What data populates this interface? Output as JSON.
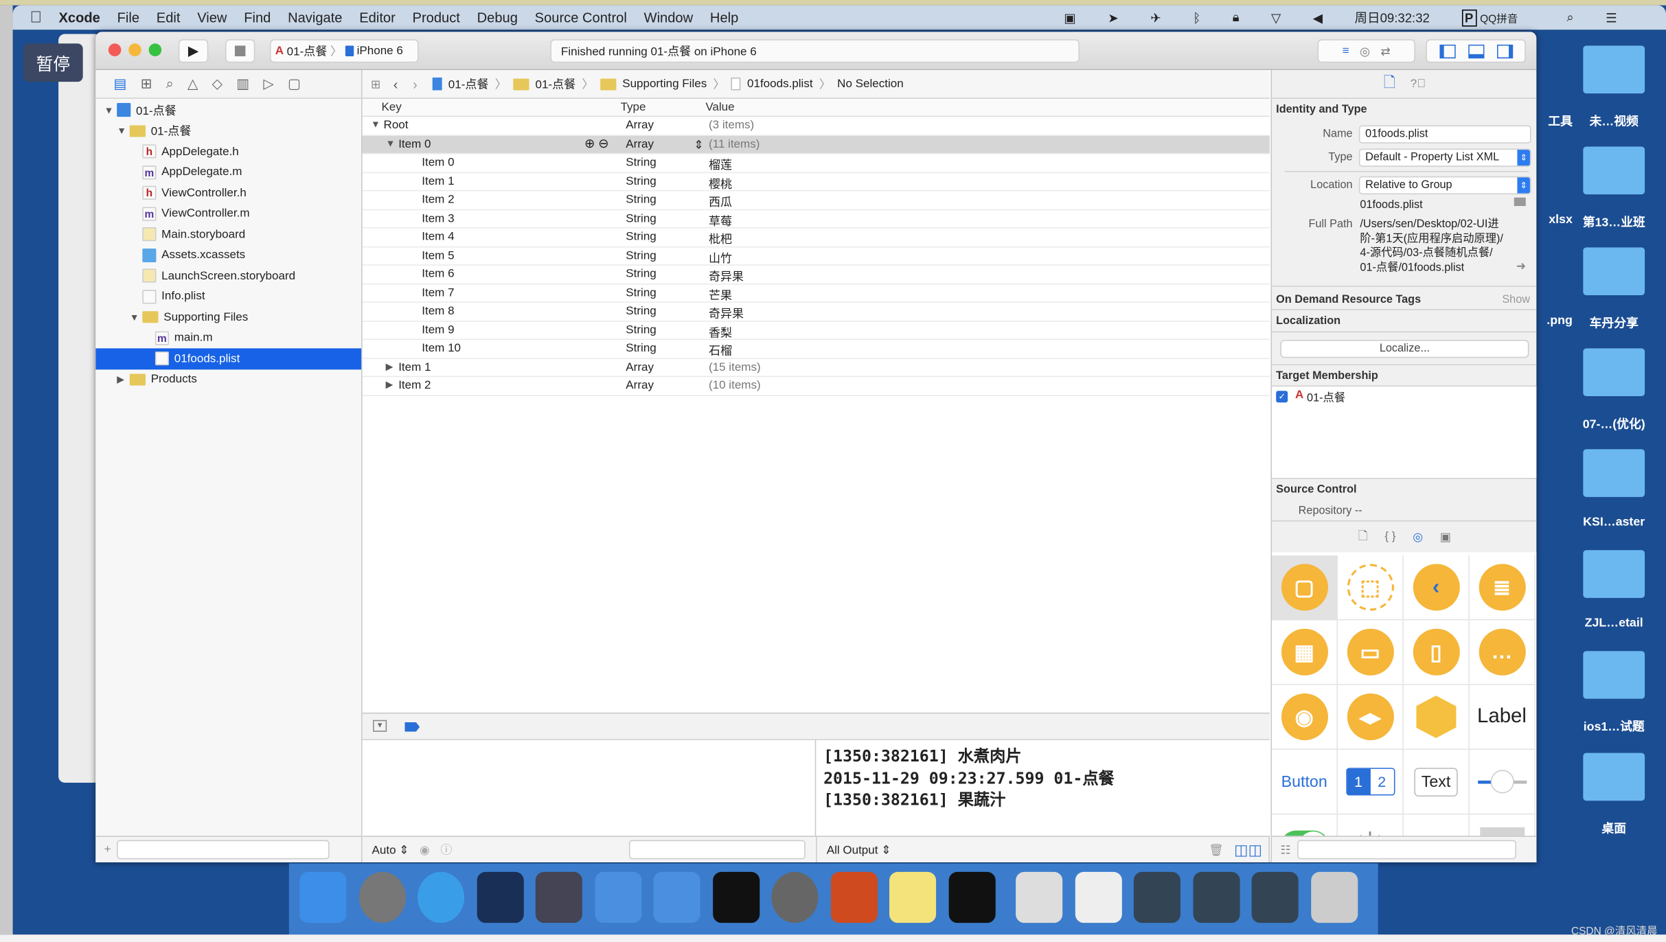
{
  "menubar": {
    "items": [
      "Xcode",
      "File",
      "Edit",
      "View",
      "Find",
      "Navigate",
      "Editor",
      "Product",
      "Debug",
      "Source Control",
      "Window",
      "Help"
    ],
    "clock": "周日09:32:32",
    "ime": "QQ拼音"
  },
  "overlay": {
    "pause": "暂停"
  },
  "toolbar": {
    "scheme": "01-点餐",
    "device": "iPhone 6",
    "activity": "Finished running 01-点餐 on iPhone 6"
  },
  "jumpbar": [
    "01-点餐",
    "01-点餐",
    "Supporting Files",
    "01foods.plist",
    "No Selection"
  ],
  "navigator": {
    "items": [
      {
        "label": "01-点餐",
        "kind": "project",
        "depth": 0,
        "open": true
      },
      {
        "label": "01-点餐",
        "kind": "folder",
        "depth": 1,
        "open": true
      },
      {
        "label": "AppDelegate.h",
        "kind": "h",
        "depth": 2
      },
      {
        "label": "AppDelegate.m",
        "kind": "m",
        "depth": 2
      },
      {
        "label": "ViewController.h",
        "kind": "h",
        "depth": 2
      },
      {
        "label": "ViewController.m",
        "kind": "m",
        "depth": 2
      },
      {
        "label": "Main.storyboard",
        "kind": "storyboard",
        "depth": 2
      },
      {
        "label": "Assets.xcassets",
        "kind": "assets",
        "depth": 2
      },
      {
        "label": "LaunchScreen.storyboard",
        "kind": "storyboard",
        "depth": 2
      },
      {
        "label": "Info.plist",
        "kind": "plist",
        "depth": 2
      },
      {
        "label": "Supporting Files",
        "kind": "folder",
        "depth": 2,
        "open": true
      },
      {
        "label": "main.m",
        "kind": "m",
        "depth": 3
      },
      {
        "label": "01foods.plist",
        "kind": "plist",
        "depth": 3,
        "selected": true
      },
      {
        "label": "Products",
        "kind": "folder",
        "depth": 1,
        "open": false
      }
    ]
  },
  "plist": {
    "headers": {
      "key": "Key",
      "type": "Type",
      "value": "Value"
    },
    "rows": [
      {
        "key": "Root",
        "type": "Array",
        "value": "(3 items)",
        "depth": 0,
        "disc": "open"
      },
      {
        "key": "Item 0",
        "type": "Array",
        "value": "(11 items)",
        "depth": 1,
        "disc": "open",
        "highlight": true
      },
      {
        "key": "Item 0",
        "type": "String",
        "value": "榴莲",
        "depth": 2
      },
      {
        "key": "Item 1",
        "type": "String",
        "value": "樱桃",
        "depth": 2
      },
      {
        "key": "Item 2",
        "type": "String",
        "value": "西瓜",
        "depth": 2
      },
      {
        "key": "Item 3",
        "type": "String",
        "value": "草莓",
        "depth": 2
      },
      {
        "key": "Item 4",
        "type": "String",
        "value": "枇杷",
        "depth": 2
      },
      {
        "key": "Item 5",
        "type": "String",
        "value": "山竹",
        "depth": 2
      },
      {
        "key": "Item 6",
        "type": "String",
        "value": "奇异果",
        "depth": 2
      },
      {
        "key": "Item 7",
        "type": "String",
        "value": "芒果",
        "depth": 2
      },
      {
        "key": "Item 8",
        "type": "String",
        "value": "奇异果",
        "depth": 2
      },
      {
        "key": "Item 9",
        "type": "String",
        "value": "香梨",
        "depth": 2
      },
      {
        "key": "Item 10",
        "type": "String",
        "value": "石榴",
        "depth": 2
      },
      {
        "key": "Item 1",
        "type": "Array",
        "value": "(15 items)",
        "depth": 1,
        "disc": "closed"
      },
      {
        "key": "Item 2",
        "type": "Array",
        "value": "(10 items)",
        "depth": 1,
        "disc": "closed"
      }
    ]
  },
  "console": {
    "lines": [
      "[1350:382161] 水煮肉片",
      "2015-11-29 09:23:27.599 01-点餐",
      "[1350:382161] 果蔬汁"
    ],
    "filter": "All Output"
  },
  "debug": {
    "auto": "Auto"
  },
  "inspector": {
    "identity_title": "Identity and Type",
    "name_label": "Name",
    "name": "01foods.plist",
    "type_label": "Type",
    "type": "Default - Property List XML",
    "location_label": "Location",
    "location": "Relative to Group",
    "filename": "01foods.plist",
    "fullpath_label": "Full Path",
    "fullpath": [
      "/Users/sen/Desktop/02-UI进",
      "阶-第1天(应用程序启动原理)/",
      "4-源代码/03-点餐随机点餐/",
      "01-点餐/01foods.plist"
    ],
    "odr_title": "On Demand Resource Tags",
    "odr_show": "Show",
    "loc_title": "Localization",
    "localize": "Localize...",
    "tm_title": "Target Membership",
    "target": "01-点餐",
    "target_checked": true,
    "sc_title": "Source Control",
    "repo_label": "Repository",
    "repo": "--"
  },
  "library": {
    "label": "Label",
    "button": "Button",
    "seg1": "1",
    "seg2": "2",
    "text": "Text"
  },
  "desktop": {
    "items": [
      "工具",
      "未…视频",
      "xlsx",
      "第13…业班",
      ".png",
      "车丹分享",
      "07-…(优化)",
      "KSI…aster",
      "ZJL…etail",
      "ios1…试题",
      "桌面"
    ]
  },
  "watermark": "CSDN @清风清晨",
  "colors": {
    "selection": "#1762e6",
    "desktop": "#1b4d92",
    "library_orange": "#f5b63a"
  }
}
